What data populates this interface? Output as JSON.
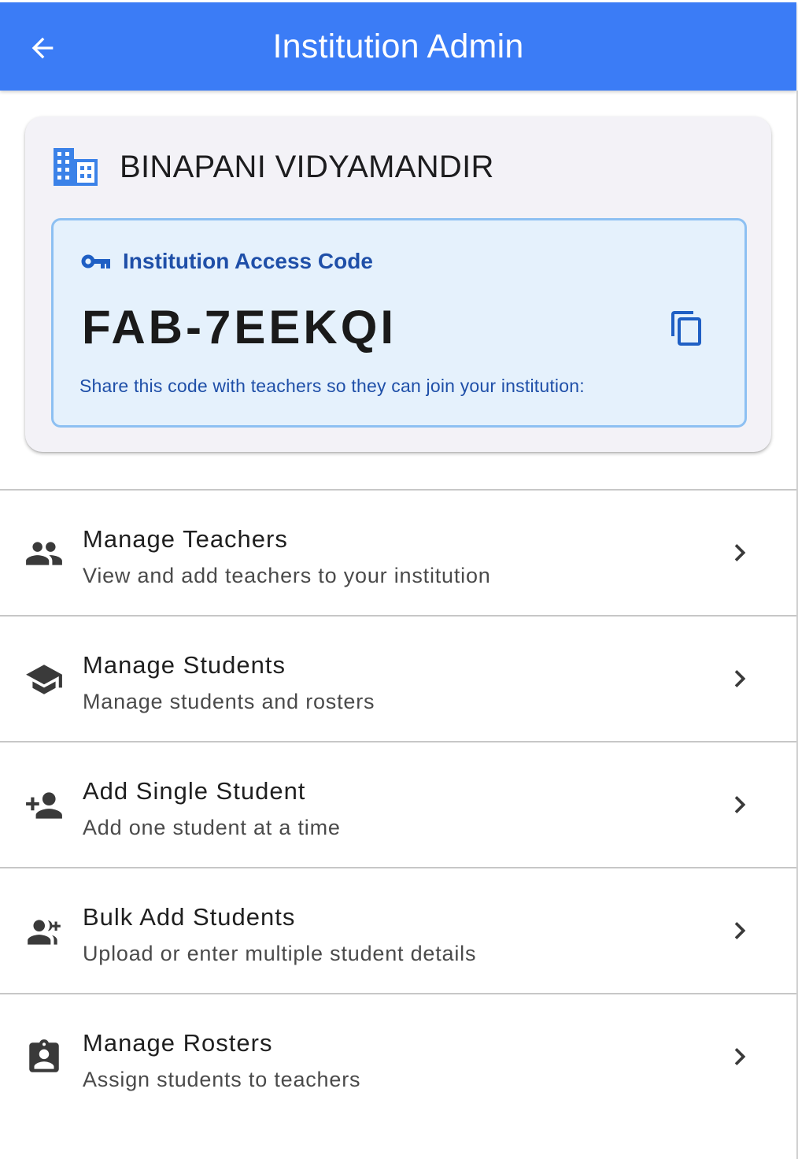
{
  "app_bar": {
    "title": "Institution Admin",
    "back_icon": "arrow-back-icon",
    "background_color": "#3b7cf6"
  },
  "institution": {
    "name": "BINAPANI VIDYAMANDIR",
    "icon": "domain-icon",
    "icon_color": "#3b82e8"
  },
  "access_code": {
    "label": "Institution Access Code",
    "value": "FAB-7EEKQI",
    "hint": "Share this code with teachers so they can join your institution:",
    "copy_icon": "copy-icon",
    "accent_color": "#1f4fa8"
  },
  "menu": {
    "items": [
      {
        "title": "Manage Teachers",
        "subtitle": "View and add teachers to your institution",
        "icon": "people-icon"
      },
      {
        "title": "Manage Students",
        "subtitle": "Manage students and rosters",
        "icon": "school-icon"
      },
      {
        "title": "Add Single Student",
        "subtitle": "Add one student at a time",
        "icon": "person-add-icon"
      },
      {
        "title": "Bulk Add Students",
        "subtitle": "Upload or enter multiple student details",
        "icon": "group-add-icon"
      },
      {
        "title": "Manage Rosters",
        "subtitle": "Assign students to teachers",
        "icon": "assignment-ind-icon"
      }
    ]
  }
}
